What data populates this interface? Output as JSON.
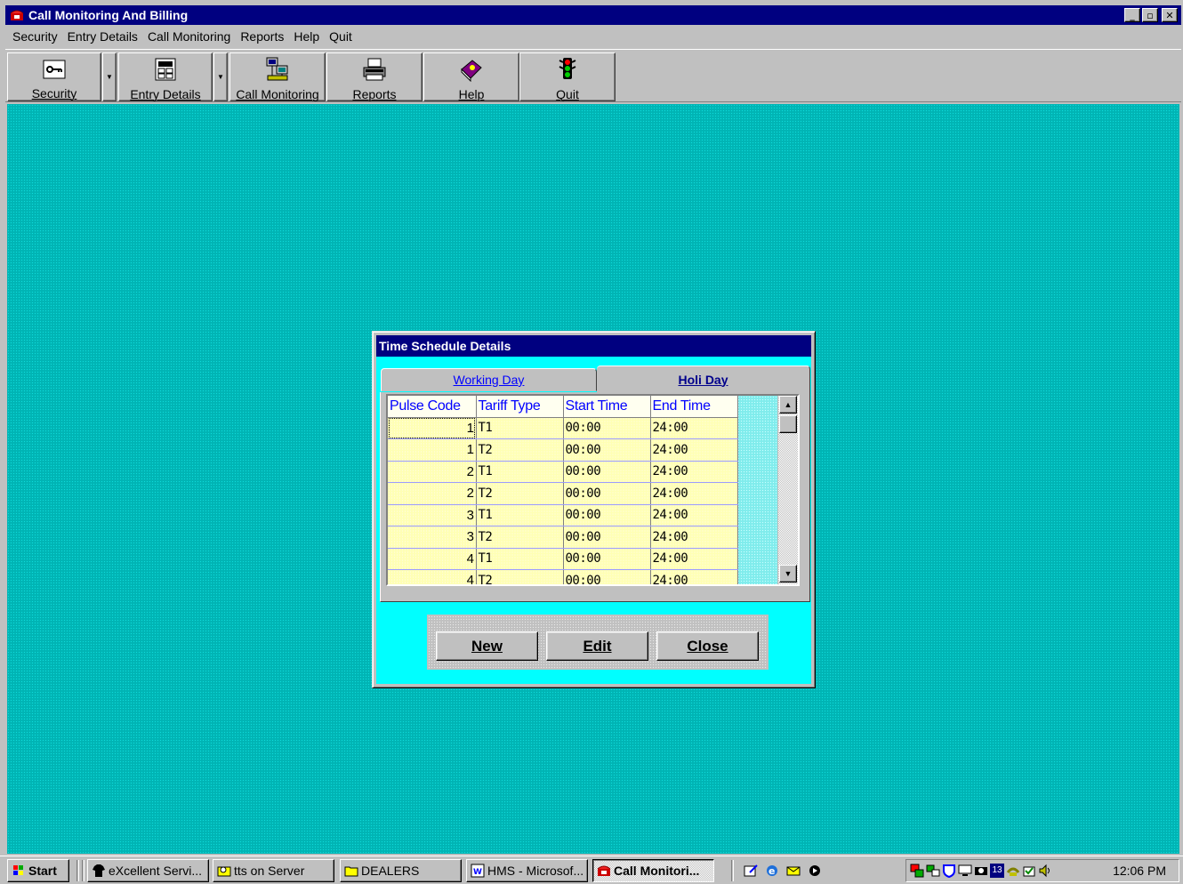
{
  "window": {
    "title": "Call Monitoring And Billing",
    "controls": {
      "minimize": "_",
      "maximize": "▫",
      "close": "✕"
    }
  },
  "menubar": [
    "Security",
    "Entry Details",
    "Call Monitoring",
    "Reports",
    "Help",
    "Quit"
  ],
  "toolbar": {
    "buttons": [
      {
        "label": "Security",
        "icon": "key-icon"
      },
      {
        "label": "Entry Details",
        "icon": "calculator-icon"
      },
      {
        "label": "Call Monitoring",
        "icon": "network-computers-icon"
      },
      {
        "label": "Reports",
        "icon": "printer-icon"
      },
      {
        "label": "Help",
        "icon": "help-book-icon"
      },
      {
        "label": "Quit",
        "icon": "traffic-light-icon"
      }
    ]
  },
  "dialog": {
    "title": "Time Schedule Details",
    "tabs": [
      {
        "label": "Working Day",
        "active": false
      },
      {
        "label": "Holi Day",
        "active": true
      }
    ],
    "grid": {
      "columns": [
        "Pulse Code",
        "Tariff Type",
        "Start Time",
        "End Time"
      ],
      "rows": [
        [
          "1",
          "T1",
          "00:00",
          "24:00"
        ],
        [
          "1",
          "T2",
          "00:00",
          "24:00"
        ],
        [
          "2",
          "T1",
          "00:00",
          "24:00"
        ],
        [
          "2",
          "T2",
          "00:00",
          "24:00"
        ],
        [
          "3",
          "T1",
          "00:00",
          "24:00"
        ],
        [
          "3",
          "T2",
          "00:00",
          "24:00"
        ],
        [
          "4",
          "T1",
          "00:00",
          "24:00"
        ],
        [
          "4",
          "T2",
          "00:00",
          "24:00"
        ]
      ]
    },
    "buttons": {
      "new": "New",
      "edit": "Edit",
      "close": "Close"
    }
  },
  "taskbar": {
    "start": "Start",
    "tasks": [
      {
        "label": "eXcellent Servi...",
        "active": false
      },
      {
        "label": "tts on Server",
        "active": false
      },
      {
        "label": "DEALERS",
        "active": false
      },
      {
        "label": "HMS - Microsof...",
        "active": false
      },
      {
        "label": "Call Monitori...",
        "active": true
      }
    ],
    "tray_badge": "13",
    "clock": "12:06 PM"
  },
  "colors": {
    "title_bar": "#000080",
    "desktop_teal": "#00b4b4",
    "dialog_cyan": "#00ffff",
    "grid_header_text": "#0000ff",
    "grid_cell_bg": "#ffffb4"
  }
}
